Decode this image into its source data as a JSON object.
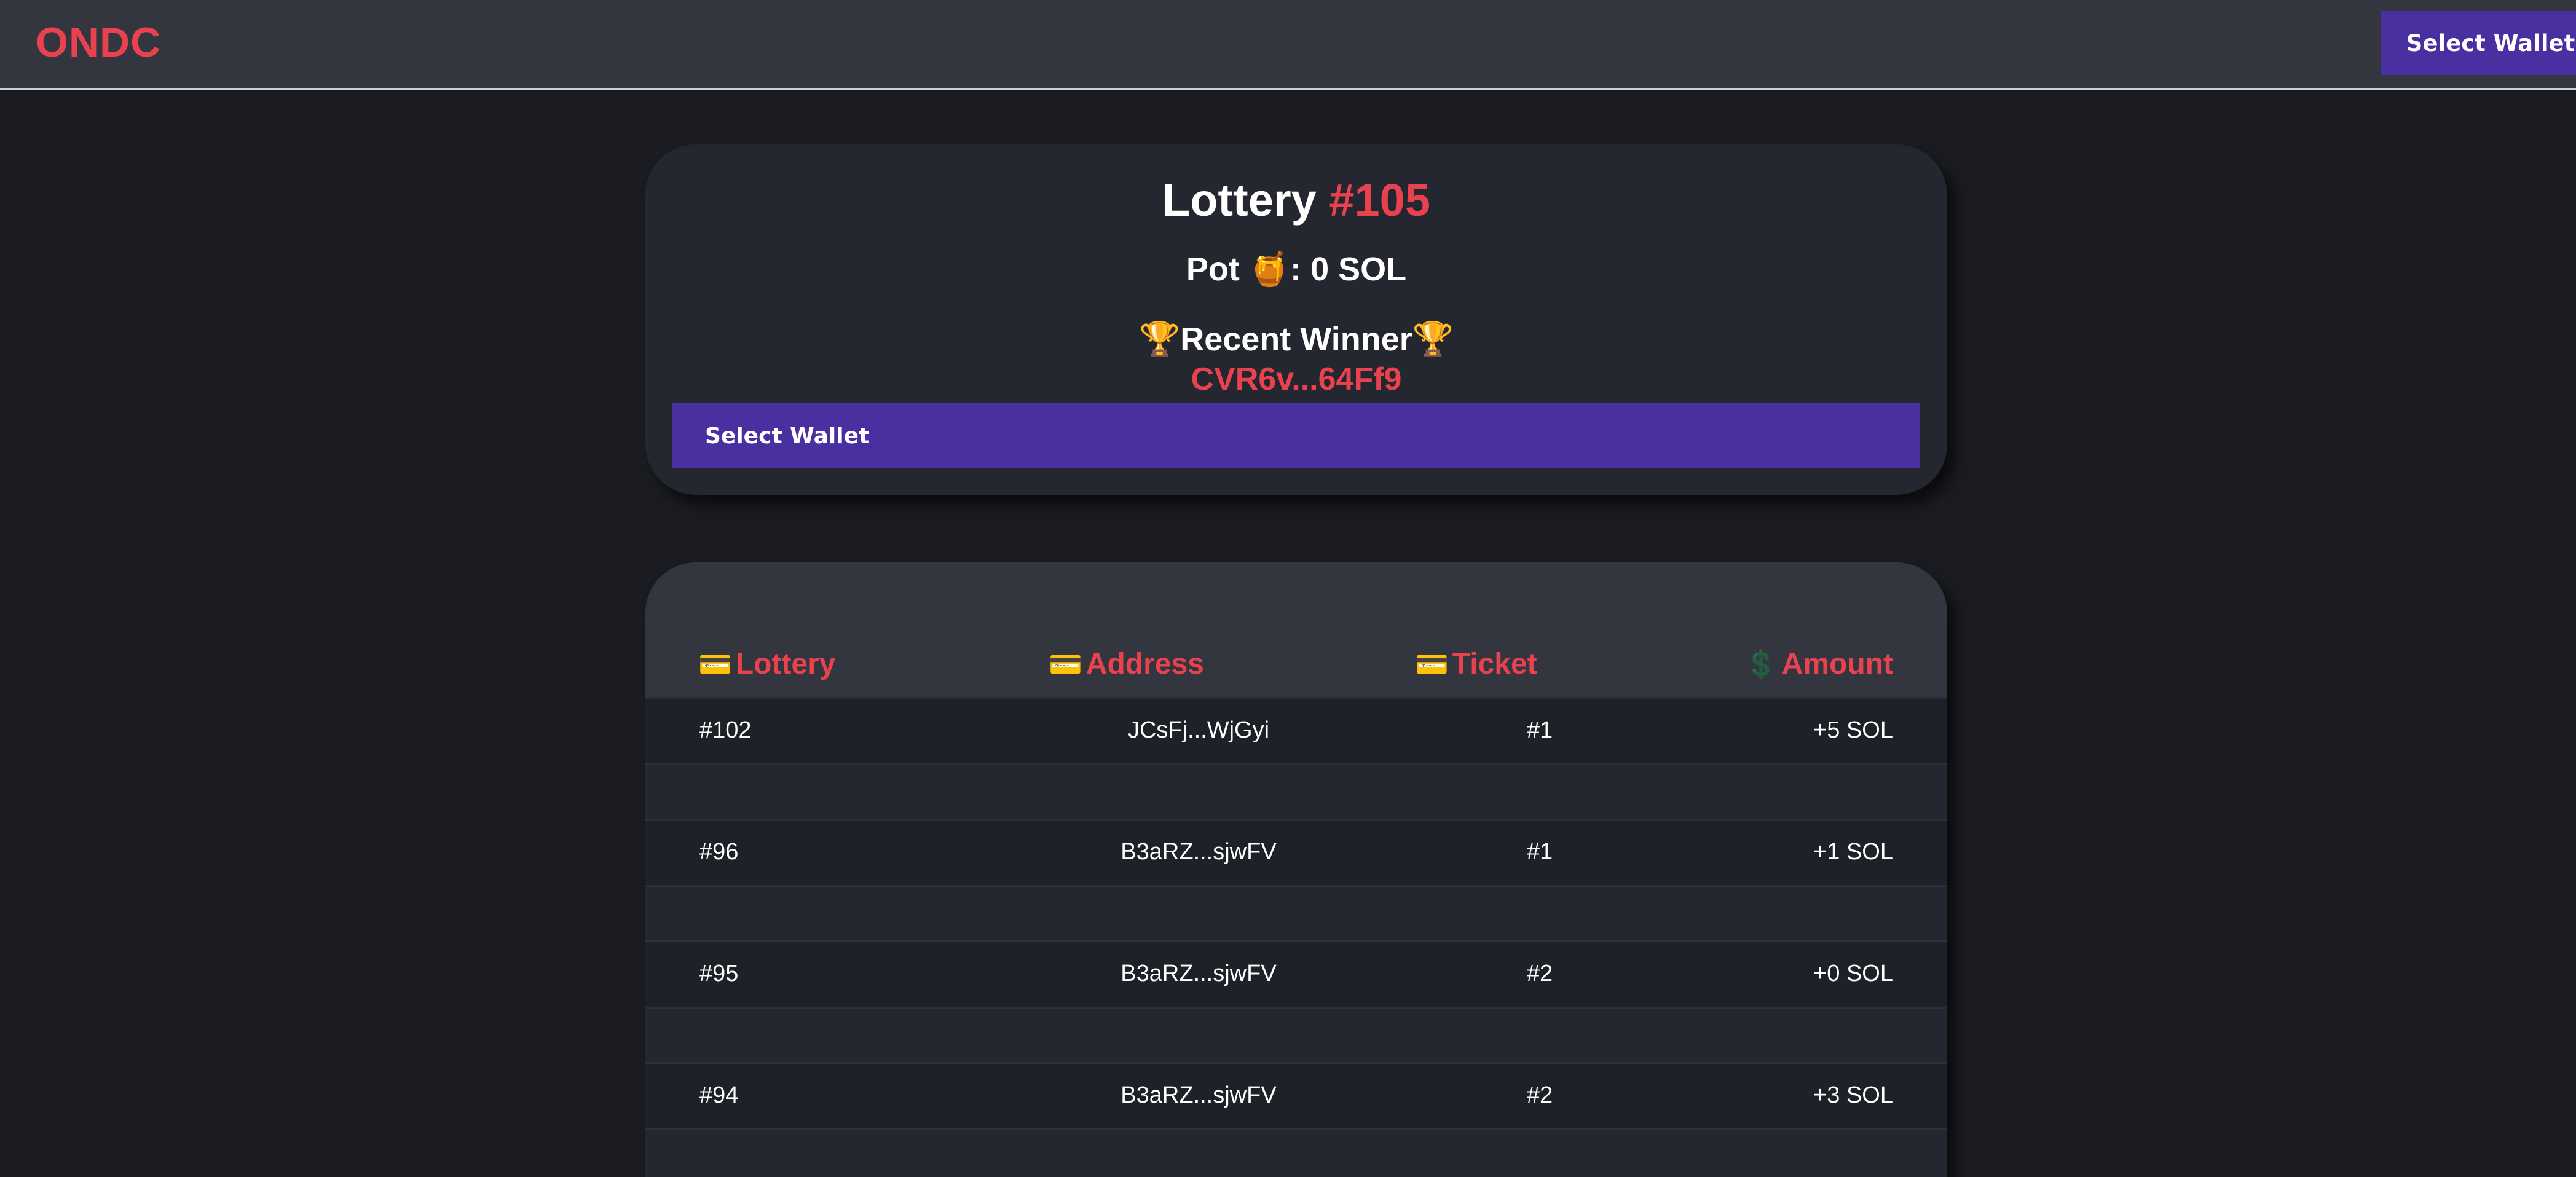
{
  "header": {
    "logo": "ONDC",
    "wallet_button": "Select Wallet"
  },
  "lottery": {
    "title_prefix": "Lottery ",
    "number": "#105",
    "pot_label": "Pot ",
    "pot_emoji": "🍯",
    "pot_value": ": 0 SOL",
    "trophy_emoji": "🏆",
    "winner_label": "Recent Winner",
    "winner_address": "CVR6v...64Ff9",
    "wallet_button": "Select Wallet"
  },
  "history": {
    "columns": [
      {
        "icon": "💳",
        "label": "Lottery"
      },
      {
        "icon": "💳",
        "label": "Address"
      },
      {
        "icon": "💳",
        "label": "Ticket"
      },
      {
        "icon": "💲",
        "label": "Amount"
      }
    ],
    "rows": [
      {
        "lottery": "#102",
        "address": "JCsFj...WjGyi",
        "ticket": "#1",
        "amount": "+5 SOL"
      },
      {
        "lottery": "#96",
        "address": "B3aRZ...sjwFV",
        "ticket": "#1",
        "amount": "+1 SOL"
      },
      {
        "lottery": "#95",
        "address": "B3aRZ...sjwFV",
        "ticket": "#2",
        "amount": "+0 SOL"
      },
      {
        "lottery": "#94",
        "address": "B3aRZ...sjwFV",
        "ticket": "#2",
        "amount": "+3 SOL"
      }
    ]
  }
}
